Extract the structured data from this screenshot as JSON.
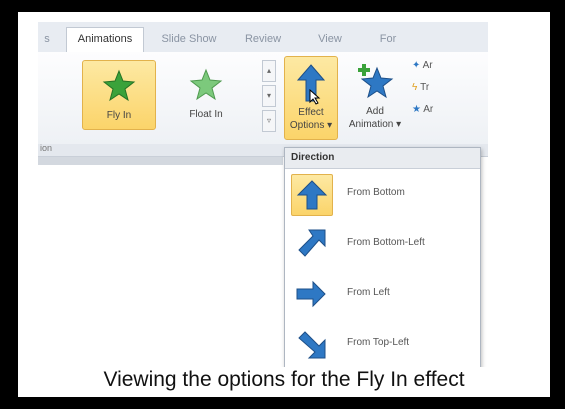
{
  "tabs": [
    {
      "label": "s"
    },
    {
      "label": "Animations"
    },
    {
      "label": "Slide Show"
    },
    {
      "label": "Review"
    },
    {
      "label": "View"
    },
    {
      "label": "For"
    }
  ],
  "gallery": [
    {
      "label": "Fly In",
      "selected": true
    },
    {
      "label": "Float In",
      "selected": false
    }
  ],
  "ribbon": {
    "effect_options": {
      "line1": "Effect",
      "line2": "Options ▾"
    },
    "add_animation": {
      "line1": "Add",
      "line2": "Animation ▾"
    },
    "small_items": [
      "Ar",
      "Tr",
      "Ar"
    ],
    "group_label": "ion"
  },
  "dropdown": {
    "header": "Direction",
    "items": [
      {
        "label": "From Bottom",
        "selected": true
      },
      {
        "label": "From Bottom-Left",
        "selected": false
      },
      {
        "label": "From Left",
        "selected": false
      },
      {
        "label": "From Top-Left",
        "selected": false
      }
    ]
  },
  "caption": "Viewing the options for the Fly In effect",
  "colors": {
    "accent_highlight": "#fbd46a",
    "arrow_blue": "#2e78c4",
    "star_green": "#3aa23a"
  }
}
